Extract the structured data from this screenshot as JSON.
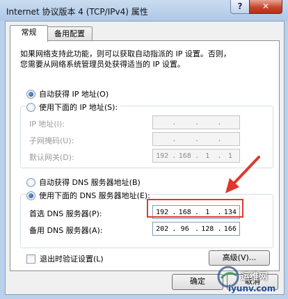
{
  "window": {
    "title": "Internet 协议版本 4 (TCP/IPv4) 属性",
    "help": "?",
    "close": "✕"
  },
  "tabs": [
    {
      "label": "常规",
      "active": true
    },
    {
      "label": "备用配置",
      "active": false
    }
  ],
  "description": [
    "如果网络支持此功能，则可以获取自动指派的 IP 设置。否则，",
    "您需要从网络系统管理员处获得适当的 IP 设置。"
  ],
  "ip_mode": {
    "auto_label": "自动获得 IP 地址(O)",
    "manual_label": "使用下面的 IP 地址(S):",
    "selected": "auto"
  },
  "ip_fields": {
    "ip_label": "IP 地址(I):",
    "mask_label": "子网掩码(U):",
    "gateway_label": "默认网关(D):",
    "ip_value": [
      "",
      "",
      "",
      ""
    ],
    "mask_value": [
      "",
      "",
      "",
      ""
    ],
    "gateway_value": [
      "192",
      "168",
      "1",
      "1"
    ]
  },
  "dns_mode": {
    "auto_label": "自动获得 DNS 服务器地址(B)",
    "manual_label": "使用下面的 DNS 服务器地址(E):",
    "selected": "manual"
  },
  "dns_fields": {
    "preferred_label": "首选 DNS 服务器(P):",
    "alternate_label": "备用 DNS 服务器(A):",
    "preferred_value": [
      "192",
      "168",
      "1",
      "134"
    ],
    "alternate_value": [
      "202",
      "96",
      "128",
      "166"
    ]
  },
  "validate_on_exit": {
    "label": "退出时验证设置(L)",
    "checked": false
  },
  "advanced_button": "高级(V)...",
  "ok_button": "确定",
  "cancel_button": "取消",
  "watermark": {
    "line1": "运维网",
    "line2": "iyunv.com"
  },
  "colors": {
    "highlight": "#e0372d",
    "accent": "#1b4f9c"
  }
}
